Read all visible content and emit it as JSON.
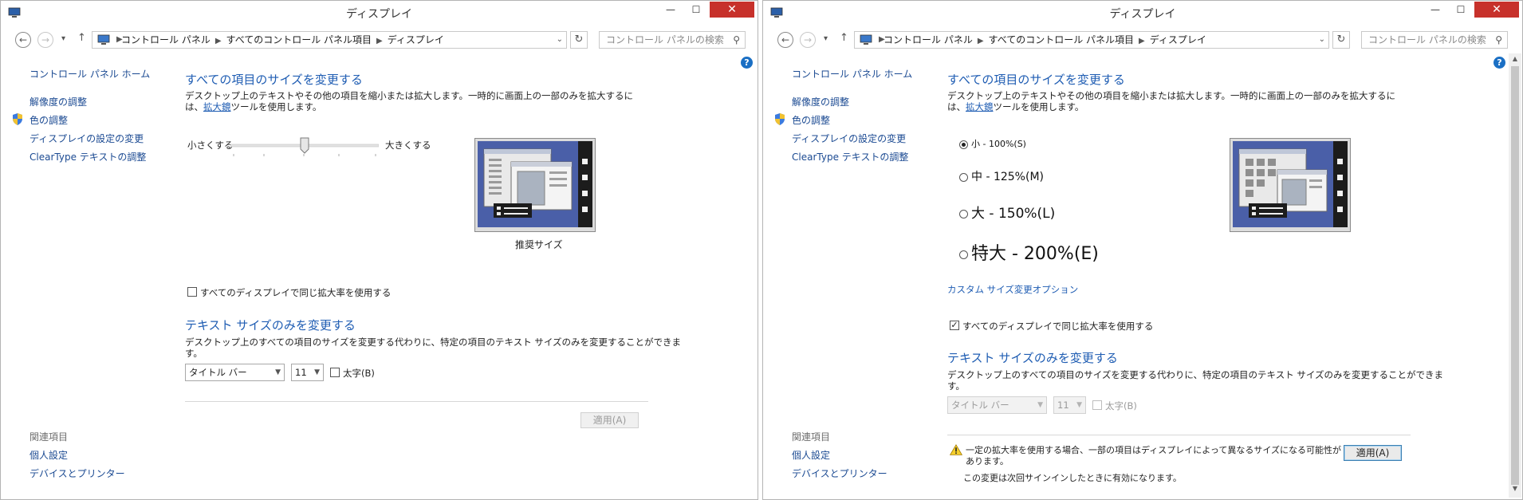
{
  "left": {
    "title": "ディスプレイ",
    "breadcrumb": [
      "コントロール パネル",
      "すべてのコントロール パネル項目",
      "ディスプレイ"
    ],
    "search_placeholder": "コントロール パネルの検索",
    "help": "?",
    "sidebar": {
      "home": "コントロール パネル ホーム",
      "items": [
        "解像度の調整",
        "色の調整",
        "ディスプレイの設定の変更",
        "ClearType テキストの調整"
      ],
      "related_heading": "関連項目",
      "related": [
        "個人設定",
        "デバイスとプリンター"
      ]
    },
    "resize": {
      "heading": "すべての項目のサイズを変更する",
      "desc_before": "デスクトップ上のテキストやその他の項目を縮小または拡大します。一時的に画面上の一部のみを拡大するには、",
      "desc_link": "拡大鏡",
      "desc_after": "ツールを使用します。",
      "slider_min": "小さくする",
      "slider_max": "大きくする",
      "slider_position": 0.5,
      "preview_caption": "推奨サイズ"
    },
    "same_scale": {
      "label": "すべてのディスプレイで同じ拡大率を使用する",
      "checked": false
    },
    "text_size": {
      "heading": "テキスト サイズのみを変更する",
      "desc": "デスクトップ上のすべての項目のサイズを変更する代わりに、特定の項目のテキスト サイズのみを変更することができます。",
      "element_select": "タイトル バー",
      "size_select": "11",
      "bold_label": "太字(B)",
      "bold_checked": false
    },
    "apply_button": "適用(A)"
  },
  "right": {
    "title": "ディスプレイ",
    "breadcrumb": [
      "コントロール パネル",
      "すべてのコントロール パネル項目",
      "ディスプレイ"
    ],
    "search_placeholder": "コントロール パネルの検索",
    "help": "?",
    "sidebar": {
      "home": "コントロール パネル ホーム",
      "items": [
        "解像度の調整",
        "色の調整",
        "ディスプレイの設定の変更",
        "ClearType テキストの調整"
      ],
      "related_heading": "関連項目",
      "related": [
        "個人設定",
        "デバイスとプリンター"
      ]
    },
    "resize": {
      "heading": "すべての項目のサイズを変更する",
      "desc_before": "デスクトップ上のテキストやその他の項目を縮小または拡大します。一時的に画面上の一部のみを拡大するには、",
      "desc_link": "拡大鏡",
      "desc_after": "ツールを使用します。",
      "options": [
        {
          "label": "小 - 100%(S)",
          "selected": true
        },
        {
          "label": "中 - 125%(M)",
          "selected": false
        },
        {
          "label": "大 - 150%(L)",
          "selected": false
        },
        {
          "label": "特大 - 200%(E)",
          "selected": false
        }
      ],
      "custom_link": "カスタム サイズ変更オプション"
    },
    "same_scale": {
      "label": "すべてのディスプレイで同じ拡大率を使用する",
      "checked": true
    },
    "text_size": {
      "heading": "テキスト サイズのみを変更する",
      "desc": "デスクトップ上のすべての項目のサイズを変更する代わりに、特定の項目のテキスト サイズのみを変更することができます。",
      "element_select": "タイトル バー",
      "size_select": "11",
      "bold_label": "太字(B)",
      "bold_checked": false
    },
    "warning": "一定の拡大率を使用する場合、一部の項目はディスプレイによって異なるサイズになる可能性があります。",
    "note": "この変更は次回サインインしたときに有効になります。",
    "apply_button": "適用(A)"
  },
  "colors": {
    "link_blue": "#1f5db3",
    "close_red": "#c7312b",
    "preview_blue": "#4a5fa8"
  }
}
